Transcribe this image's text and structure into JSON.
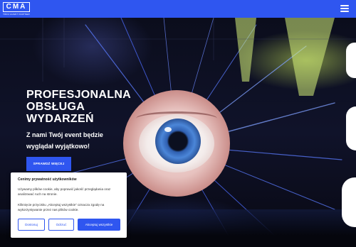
{
  "header": {
    "logo_text": "CMA",
    "logo_tagline": "TWOJ EVENT PARTNER",
    "menu_icon": "hamburger-menu-icon",
    "brand_color": "#2f56f0"
  },
  "hero": {
    "title_lines": [
      "PROFESJONALNA",
      "OBSŁUGA",
      "WYDARZEŃ"
    ],
    "subtitle": "Z nami Twój event będzie wyglądał wyjątkowo!",
    "cta_label": "SPRAWDŹ WIĘCEJ"
  },
  "cookie_banner": {
    "title": "Cenimy prywatność użytkowników",
    "paragraph1": "Używamy plików cookie, aby poprawić jakość przeglądania oraz analizować ruch na stronie.",
    "paragraph2": "Kliknięcie przycisku „Akceptuj wszystkie” oznacza zgodę na wykorzystywanie przez nas plików cookie.",
    "buttons": {
      "customize": "Dostosuj",
      "reject": "Odrzuć",
      "accept_all": "Akceptuj wszystkie"
    }
  }
}
